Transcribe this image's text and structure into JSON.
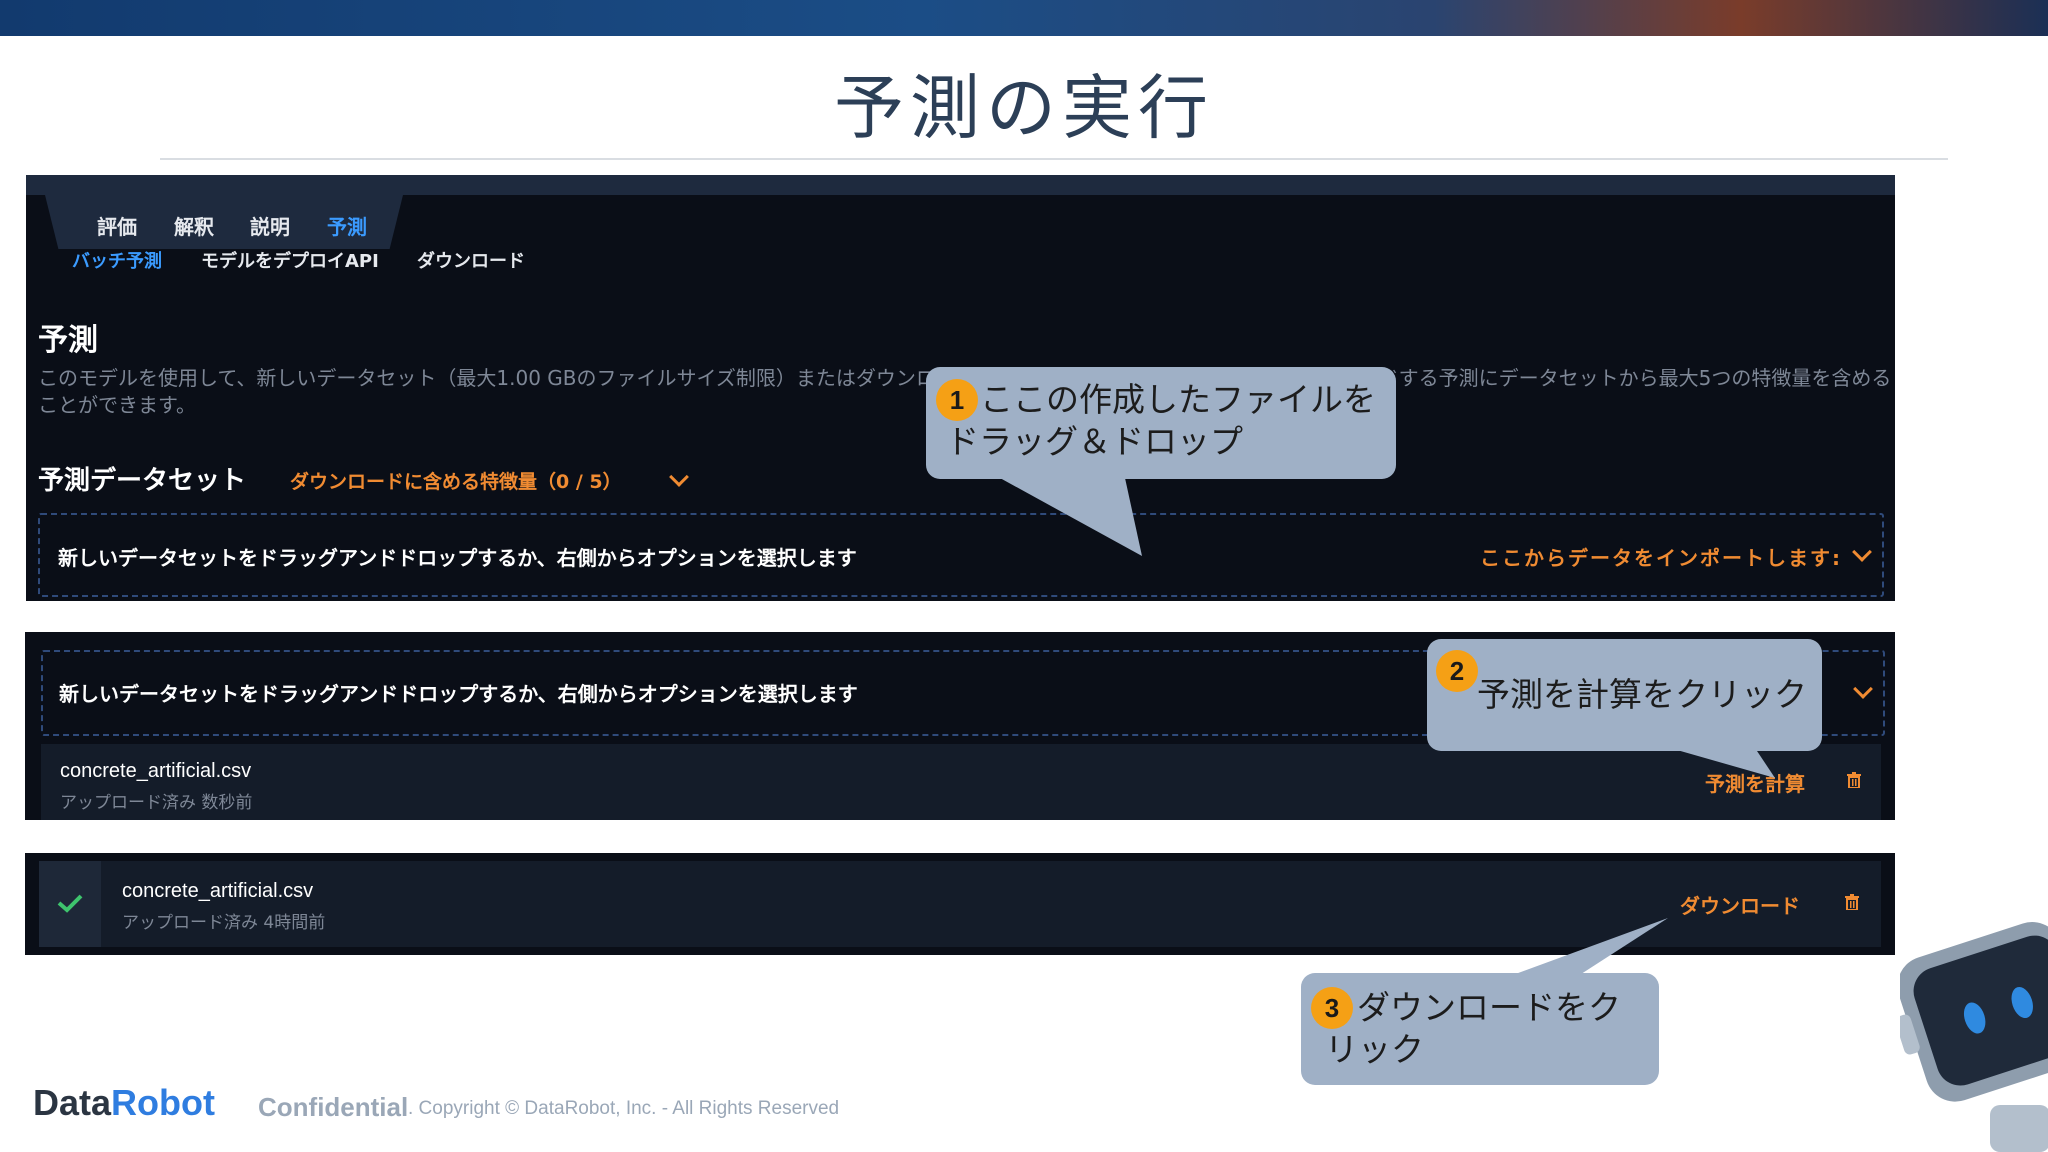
{
  "slide": {
    "title": "予測の実行"
  },
  "tabs": [
    {
      "label": "評価",
      "active": false
    },
    {
      "label": "解釈",
      "active": false
    },
    {
      "label": "説明",
      "active": false
    },
    {
      "label": "予測",
      "active": true
    }
  ],
  "subtabs": [
    {
      "label": "バッチ予測",
      "active": true
    },
    {
      "label": "モデルをデプロイAPI",
      "active": false
    },
    {
      "label": "ダウンロード",
      "active": false
    }
  ],
  "predict": {
    "heading": "予測",
    "description": "このモデルを使用して、新しいデータセット（最大1.00 GBのファイルサイズ制限）またはダウンロードを行います。 オプションとして、ダウンロードする予測にデータセットから最大5つの特徴量を含めることができます。"
  },
  "dataset": {
    "heading": "予測データセット",
    "features_link": "ダウンロードに含める特徴量（0 / 5）",
    "dropzone_text": "新しいデータセットをドラッグアンドドロップするか、右側からオプションを選択します",
    "import_label": "ここからデータをインポートします:"
  },
  "panel2": {
    "dropzone_text": "新しいデータセットをドラッグアンドドロップするか、右側からオプションを選択します",
    "file": {
      "name": "concrete_artificial.csv",
      "status": "アップロード済み 数秒前",
      "action": "予測を計算"
    }
  },
  "panel3": {
    "file": {
      "name": "concrete_artificial.csv",
      "status": "アップロード済み 4時間前",
      "action": "ダウンロード"
    }
  },
  "callouts": [
    {
      "number": "1",
      "text": "ここの作成したファイルをドラッグ＆ドロップ"
    },
    {
      "number": "2",
      "text": "予測を計算をクリック"
    },
    {
      "number": "3",
      "text": "ダウンロードをクリック"
    }
  ],
  "footer": {
    "logo_part1": "Data",
    "logo_part2": "Robot",
    "confidential": "Confidential",
    "copyright": ". Copyright © DataRobot, Inc. - All Rights Reserved"
  },
  "colors": {
    "accent": "#f08b32",
    "link": "#3b9bff",
    "panel_bg": "#0a0e17",
    "callout": "#9fb0c6",
    "badge": "#f5a015"
  },
  "icons": [
    "trash-icon",
    "checkmark-icon",
    "chevron-down-icon",
    "robot-mascot"
  ]
}
